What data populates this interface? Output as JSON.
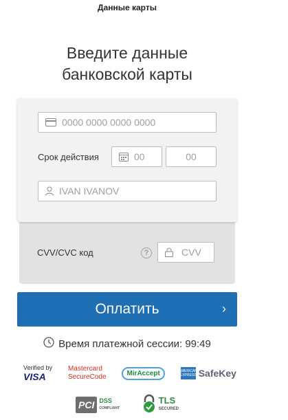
{
  "page": {
    "top_title": "Данные карты",
    "heading_line1": "Введите данные",
    "heading_line2": "банковской карты"
  },
  "card": {
    "number_placeholder": "0000 0000 0000 0000",
    "expiry_label": "Срок действия",
    "expiry_month_placeholder": "00",
    "expiry_year_placeholder": "00",
    "holder_placeholder": "IVAN IVANOV",
    "cvv_label": "CVV/CVC код",
    "cvv_placeholder": "CVV",
    "help_glyph": "?"
  },
  "actions": {
    "pay_label": "Оплатить",
    "pay_chevron": "›"
  },
  "session": {
    "timer_label": "Время платежной сессии: 99:49"
  },
  "logos": {
    "visa_top": "Verified by",
    "visa_main": "VISA",
    "mc_top": "Mastercard",
    "mc_bottom": "SecureCode",
    "mir": "MirAccept",
    "amex_box": "AMERICAN EXPRESS",
    "safekey": "SafeKey",
    "pci": "PCI",
    "pci_dss": "DSS",
    "pci_sub": "COMPLIANT",
    "tls": "TLS",
    "tls_sub": "SECURED"
  },
  "colors": {
    "accent": "#1f6fb5",
    "card_bg": "#f2f2f2",
    "cvv_bg": "#e2e2e2"
  },
  "icons": [
    "card-icon",
    "calendar-icon",
    "user-icon",
    "lock-icon",
    "help-icon",
    "clock-icon",
    "chevron-right-icon",
    "padlock-icon"
  ]
}
